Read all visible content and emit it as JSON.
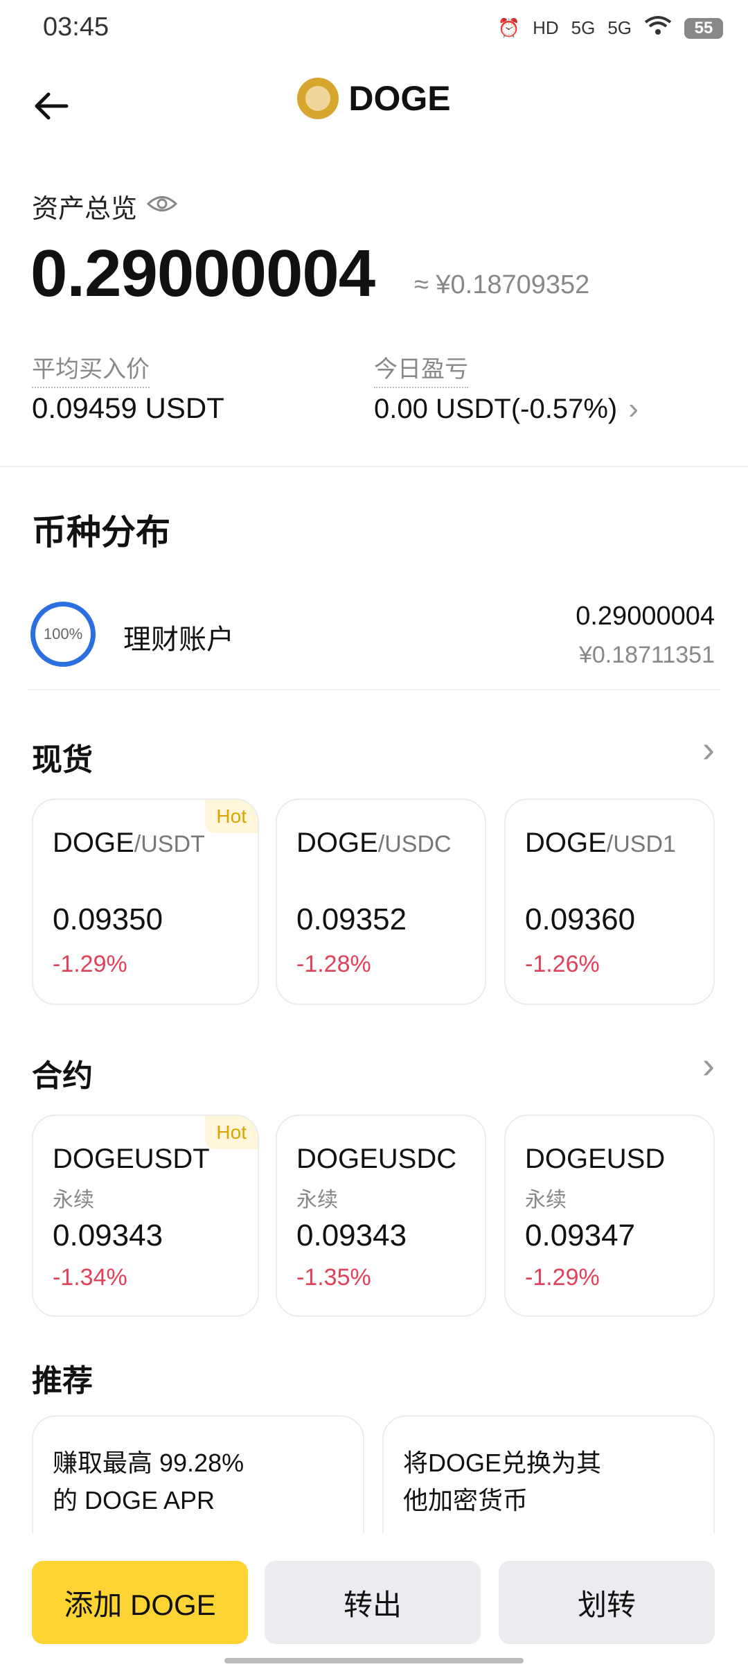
{
  "status_bar": {
    "time": "03:45",
    "network1": "5G",
    "network2": "5G",
    "hd": "HD",
    "battery": "55"
  },
  "header": {
    "title": "DOGE"
  },
  "overview": {
    "label": "资产总览",
    "balance": "0.29000004",
    "balance_cny": "≈ ¥0.18709352",
    "avg_price_label": "平均买入价",
    "avg_price_value": "0.09459 USDT",
    "today_pnl_label": "今日盈亏",
    "today_pnl_value": "0.00 USDT(-0.57%)"
  },
  "distribution": {
    "title": "币种分布",
    "items": [
      {
        "percent": "100%",
        "name": "理财账户",
        "value": "0.29000004",
        "cny": "¥0.18711351"
      }
    ]
  },
  "spot": {
    "title": "现货",
    "cards": [
      {
        "base": "DOGE",
        "quote": "/USDT",
        "hot": "Hot",
        "price": "0.09350",
        "change": "-1.29%"
      },
      {
        "base": "DOGE",
        "quote": "/USDC",
        "price": "0.09352",
        "change": "-1.28%"
      },
      {
        "base": "DOGE",
        "quote": "/USD1",
        "price": "0.09360",
        "change": "-1.26%"
      }
    ]
  },
  "futures": {
    "title": "合约",
    "cards": [
      {
        "pair": "DOGEUSDT",
        "hot": "Hot",
        "type": "永续",
        "price": "0.09343",
        "change": "-1.34%"
      },
      {
        "pair": "DOGEUSDC",
        "type": "永续",
        "price": "0.09343",
        "change": "-1.35%"
      },
      {
        "pair": "DOGEUSD",
        "type": "永续",
        "price": "0.09347",
        "change": "-1.29%"
      }
    ]
  },
  "recommend": {
    "title": "推荐",
    "cards": [
      {
        "line1": "赚取最高 99.28%",
        "line2": "的 DOGE APR"
      },
      {
        "line1": "将DOGE兑换为其",
        "line2": "他加密货币"
      }
    ]
  },
  "actions": {
    "add": "添加 DOGE",
    "transfer_out": "转出",
    "transfer": "划转"
  },
  "colors": {
    "accent": "#fcd535",
    "negative": "#e0415a",
    "ring": "#2c6fe0"
  }
}
